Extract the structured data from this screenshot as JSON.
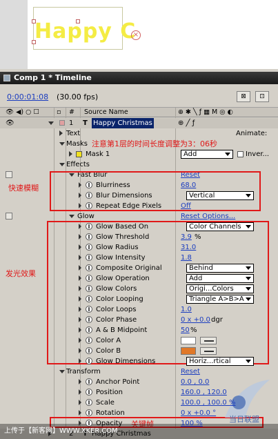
{
  "preview": {
    "text": "Happy C"
  },
  "window": {
    "title": "Comp 1 * Timeline"
  },
  "toolbar": {
    "time": "0:00:01:08",
    "fps": "(30.00 fps)"
  },
  "header": {
    "hash": "#",
    "source_name": "Source Name",
    "animate": "Animate:"
  },
  "layer1": {
    "num": "1",
    "name": "Happy Christmas"
  },
  "text_group": "Text",
  "masks": {
    "label": "Masks",
    "note": "注意第1层的时间长度调整为3：06秒"
  },
  "mask1": {
    "label": "Mask 1",
    "mode": "Add",
    "invert": "Inver..."
  },
  "effects": "Effects",
  "fast_blur": {
    "label": "Fast Blur",
    "reset": "Reset",
    "props": [
      {
        "name": "Blurriness",
        "value": "68.0"
      },
      {
        "name": "Blur Dimensions",
        "value": "Vertical"
      },
      {
        "name": "Repeat Edge Pixels",
        "value": "Off"
      }
    ]
  },
  "glow": {
    "label": "Glow",
    "reset": "Reset Options...",
    "props": [
      {
        "name": "Glow Based On",
        "value": "Color Channels"
      },
      {
        "name": "Glow Threshold",
        "value": "3.9",
        "unit": "%"
      },
      {
        "name": "Glow Radius",
        "value": "31.0"
      },
      {
        "name": "Glow Intensity",
        "value": "1.8"
      },
      {
        "name": "Composite Original",
        "value": "Behind"
      },
      {
        "name": "Glow Operation",
        "value": "Add"
      },
      {
        "name": "Glow Colors",
        "value": "Origi...Colors"
      },
      {
        "name": "Color Looping",
        "value": "Triangle A>B>A"
      },
      {
        "name": "Color Loops",
        "value": "1.0"
      },
      {
        "name": "Color Phase",
        "value": "0 x +0.0",
        "unit": "dgr"
      },
      {
        "name": "A & B Midpoint",
        "value": "50",
        "unit": "%"
      },
      {
        "name": "Color A",
        "color": "#ffffff"
      },
      {
        "name": "Color B",
        "color": "#e07828"
      },
      {
        "name": "Glow Dimensions",
        "value": "Horiz...rtical"
      }
    ]
  },
  "transform": {
    "label": "Transform",
    "reset": "Reset",
    "props": [
      {
        "name": "Anchor Point",
        "value": "0.0 , 0.0"
      },
      {
        "name": "Position",
        "value": "160.0 , 120.0"
      },
      {
        "name": "Scale",
        "value": "100.0 , 100.0 %"
      },
      {
        "name": "Rotation",
        "value": "0 x +0.0 °"
      },
      {
        "name": "Opacity",
        "value": "100 %"
      }
    ]
  },
  "layer2": {
    "num": "2",
    "name": "Happy Christmas"
  },
  "annotations": {
    "fast_blur": "快速模糊",
    "glow": "发光效果",
    "keyframe": "关键帧"
  },
  "watermark": "上传于【新客网】WWW.XKER.COM",
  "logo_text": "当日联盟",
  "colors": {
    "accent": "#e01818",
    "link": "#1a3cbf"
  }
}
